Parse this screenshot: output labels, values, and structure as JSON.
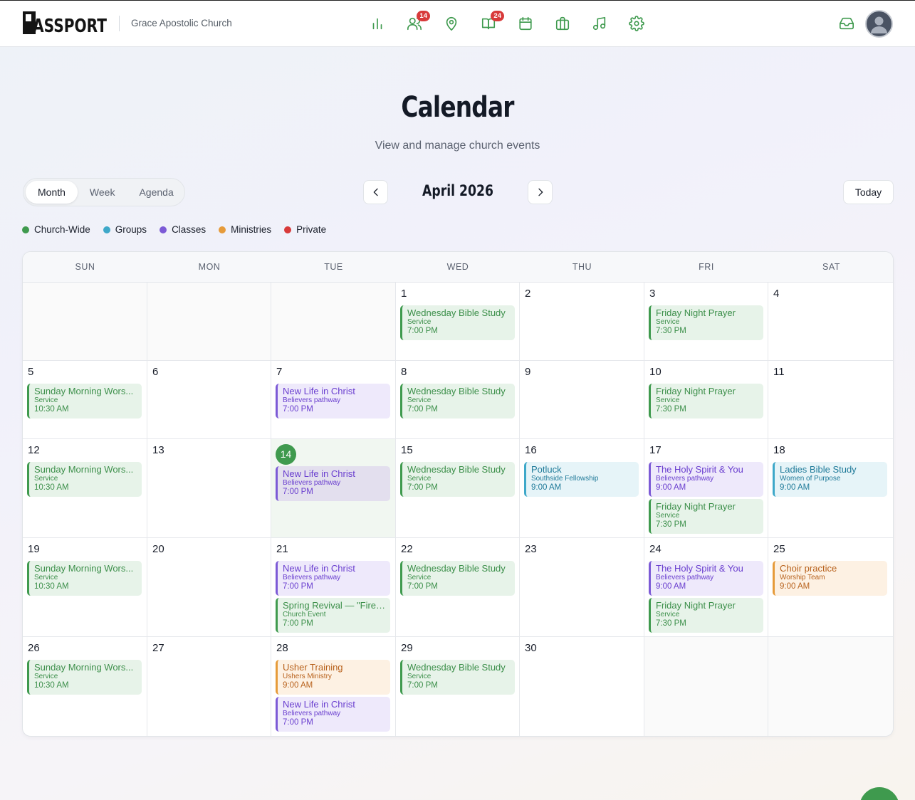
{
  "header": {
    "brand": "PASSPORT",
    "church_name": "Grace Apostolic Church",
    "nav": [
      {
        "icon": "bar-chart-icon",
        "badge": ""
      },
      {
        "icon": "people-icon",
        "badge": "14"
      },
      {
        "icon": "map-pin-icon",
        "badge": ""
      },
      {
        "icon": "book-open-icon",
        "badge": "24"
      },
      {
        "icon": "calendar-icon",
        "badge": ""
      },
      {
        "icon": "briefcase-icon",
        "badge": ""
      },
      {
        "icon": "music-icon",
        "badge": ""
      },
      {
        "icon": "settings-icon",
        "badge": ""
      }
    ],
    "inbox_icon": "inbox-icon",
    "avatar_icon": "user-avatar-icon"
  },
  "page": {
    "title": "Calendar",
    "subtitle": "View and manage church events"
  },
  "toolbar": {
    "views": [
      "Month",
      "Week",
      "Agenda"
    ],
    "active_view": "Month",
    "month_label": "April 2026",
    "today_label": "Today"
  },
  "legend": [
    {
      "label": "Church-Wide",
      "color": "#3f9a4e"
    },
    {
      "label": "Groups",
      "color": "#3ea8c9"
    },
    {
      "label": "Classes",
      "color": "#7c5ad6"
    },
    {
      "label": "Ministries",
      "color": "#e69b3a"
    },
    {
      "label": "Private",
      "color": "#d83a3a"
    }
  ],
  "calendar": {
    "weekdays": [
      "SUN",
      "MON",
      "TUE",
      "WED",
      "THU",
      "FRI",
      "SAT"
    ],
    "today": 14,
    "weeks": [
      [
        null,
        null,
        null,
        {
          "day": 1,
          "events": [
            {
              "title": "Wednesday Bible Study",
              "sub": "Service",
              "time": "7:00 PM",
              "kind": "green"
            }
          ]
        },
        {
          "day": 2,
          "events": []
        },
        {
          "day": 3,
          "events": [
            {
              "title": "Friday Night Prayer",
              "sub": "Service",
              "time": "7:30 PM",
              "kind": "green"
            }
          ]
        },
        {
          "day": 4,
          "events": []
        }
      ],
      [
        {
          "day": 5,
          "events": [
            {
              "title": "Sunday Morning Wors...",
              "sub": "Service",
              "time": "10:30 AM",
              "kind": "green"
            }
          ]
        },
        {
          "day": 6,
          "events": []
        },
        {
          "day": 7,
          "events": [
            {
              "title": "New Life in Christ",
              "sub": "Believers pathway",
              "time": "7:00 PM",
              "kind": "purple"
            }
          ]
        },
        {
          "day": 8,
          "events": [
            {
              "title": "Wednesday Bible Study",
              "sub": "Service",
              "time": "7:00 PM",
              "kind": "green"
            }
          ]
        },
        {
          "day": 9,
          "events": []
        },
        {
          "day": 10,
          "events": [
            {
              "title": "Friday Night Prayer",
              "sub": "Service",
              "time": "7:30 PM",
              "kind": "green"
            }
          ]
        },
        {
          "day": 11,
          "events": []
        }
      ],
      [
        {
          "day": 12,
          "events": [
            {
              "title": "Sunday Morning Wors...",
              "sub": "Service",
              "time": "10:30 AM",
              "kind": "green"
            }
          ]
        },
        {
          "day": 13,
          "events": []
        },
        {
          "day": 14,
          "events": [
            {
              "title": "New Life in Christ",
              "sub": "Believers pathway",
              "time": "7:00 PM",
              "kind": "purple"
            }
          ]
        },
        {
          "day": 15,
          "events": [
            {
              "title": "Wednesday Bible Study",
              "sub": "Service",
              "time": "7:00 PM",
              "kind": "green"
            }
          ]
        },
        {
          "day": 16,
          "events": [
            {
              "title": "Potluck",
              "sub": "Southside Fellowship",
              "time": "9:00 AM",
              "kind": "blue"
            }
          ]
        },
        {
          "day": 17,
          "events": [
            {
              "title": "The Holy Spirit & You",
              "sub": "Believers pathway",
              "time": "9:00 AM",
              "kind": "purple"
            },
            {
              "title": "Friday Night Prayer",
              "sub": "Service",
              "time": "7:30 PM",
              "kind": "green"
            }
          ]
        },
        {
          "day": 18,
          "events": [
            {
              "title": "Ladies Bible Study",
              "sub": "Women of Purpose",
              "time": "9:00 AM",
              "kind": "blue"
            }
          ]
        }
      ],
      [
        {
          "day": 19,
          "events": [
            {
              "title": "Sunday Morning Wors...",
              "sub": "Service",
              "time": "10:30 AM",
              "kind": "green"
            }
          ]
        },
        {
          "day": 20,
          "events": []
        },
        {
          "day": 21,
          "events": [
            {
              "title": "New Life in Christ",
              "sub": "Believers pathway",
              "time": "7:00 PM",
              "kind": "purple"
            },
            {
              "title": "Spring Revival — \"Fire ...",
              "sub": "Church Event",
              "time": "7:00 PM",
              "kind": "green"
            }
          ]
        },
        {
          "day": 22,
          "events": [
            {
              "title": "Wednesday Bible Study",
              "sub": "Service",
              "time": "7:00 PM",
              "kind": "green"
            }
          ]
        },
        {
          "day": 23,
          "events": []
        },
        {
          "day": 24,
          "events": [
            {
              "title": "The Holy Spirit & You",
              "sub": "Believers pathway",
              "time": "9:00 AM",
              "kind": "purple"
            },
            {
              "title": "Friday Night Prayer",
              "sub": "Service",
              "time": "7:30 PM",
              "kind": "green"
            }
          ]
        },
        {
          "day": 25,
          "events": [
            {
              "title": "Choir practice",
              "sub": "Worship Team",
              "time": "9:00 AM",
              "kind": "orange"
            }
          ]
        }
      ],
      [
        {
          "day": 26,
          "events": [
            {
              "title": "Sunday Morning Wors...",
              "sub": "Service",
              "time": "10:30 AM",
              "kind": "green"
            }
          ]
        },
        {
          "day": 27,
          "events": []
        },
        {
          "day": 28,
          "events": [
            {
              "title": "Usher Training",
              "sub": "Ushers Ministry",
              "time": "9:00 AM",
              "kind": "orange"
            },
            {
              "title": "New Life in Christ",
              "sub": "Believers pathway",
              "time": "7:00 PM",
              "kind": "purple"
            }
          ]
        },
        {
          "day": 29,
          "events": [
            {
              "title": "Wednesday Bible Study",
              "sub": "Service",
              "time": "7:00 PM",
              "kind": "green"
            }
          ]
        },
        {
          "day": 30,
          "events": []
        },
        null,
        null
      ]
    ]
  }
}
